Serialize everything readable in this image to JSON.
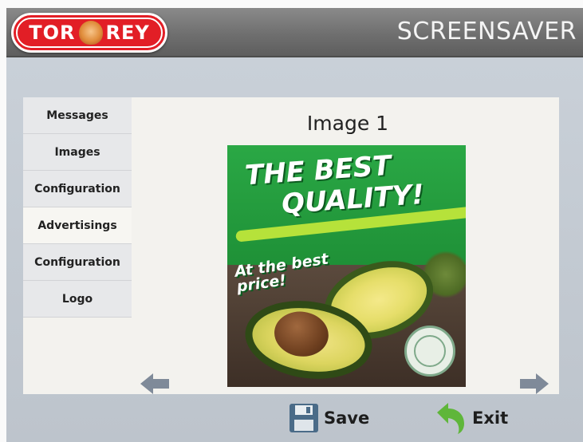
{
  "header": {
    "brand_left": "TOR",
    "brand_right": "REY",
    "title": "SCREENSAVER"
  },
  "menu": {
    "items": [
      {
        "label": "Messages",
        "active": false
      },
      {
        "label": "Images",
        "active": false
      },
      {
        "label": "Configuration",
        "active": false
      },
      {
        "label": "Advertisings",
        "active": true
      },
      {
        "label": "Configuration",
        "active": false
      },
      {
        "label": "Logo",
        "active": false
      }
    ]
  },
  "preview": {
    "title": "Image 1",
    "ad_line1": "THE BEST",
    "ad_line2": "QUALITY!",
    "ad_line3": "At the best price!"
  },
  "nav": {
    "prev_icon": "arrow-left-icon",
    "next_icon": "arrow-right-icon"
  },
  "actions": {
    "save_label": "Save",
    "exit_label": "Exit",
    "save_icon": "floppy-disk-icon",
    "exit_icon": "return-arrow-icon"
  },
  "colors": {
    "brand_red": "#e21e26",
    "header_gray": "#6f6f6f",
    "panel_blue_gray": "#c9d0d8",
    "ad_green": "#1e8f36",
    "save_icon": "#4a6b88",
    "exit_icon": "#5fb63a"
  }
}
